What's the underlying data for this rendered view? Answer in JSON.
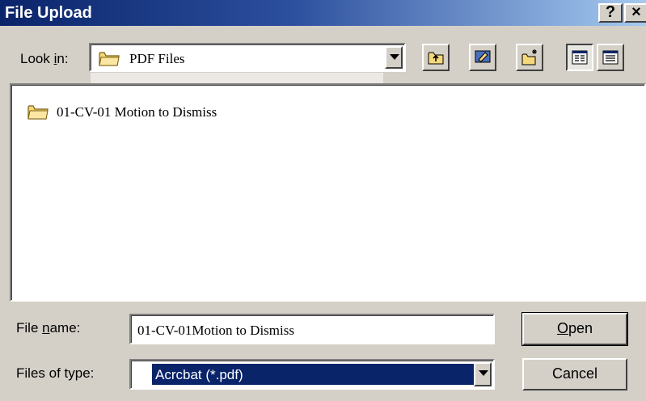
{
  "window": {
    "title": "File Upload",
    "help_label": "?",
    "close_label": "×"
  },
  "look_in": {
    "label_prefix": "Look ",
    "label_accel": "i",
    "label_suffix": "n:",
    "value": "PDF Files",
    "icon": "folder-icon"
  },
  "toolbar": {
    "buttons": [
      {
        "name": "up-one-level",
        "icon": "up-folder-icon"
      },
      {
        "name": "go-to-desktop",
        "icon": "desktop-icon"
      },
      {
        "name": "new-folder",
        "icon": "new-folder-icon"
      },
      {
        "name": "list-view",
        "icon": "list-view-icon",
        "pressed": true
      },
      {
        "name": "details-view",
        "icon": "details-view-icon"
      }
    ]
  },
  "file_list": {
    "items": [
      {
        "label": "01-CV-01 Motion to Dismiss",
        "icon": "folder-icon"
      }
    ]
  },
  "file_name": {
    "label_prefix": "File ",
    "label_accel": "n",
    "label_suffix": "ame:",
    "value": "01-CV-01Motion to Dismiss"
  },
  "file_type": {
    "label": "Files of type:",
    "value": "Acrcbat (*.pdf)"
  },
  "buttons": {
    "open_accel": "O",
    "open_rest": "pen",
    "cancel": "Cancel"
  },
  "colors": {
    "title_gradient_start": "#0a246a",
    "title_gradient_end": "#a6caf0",
    "dialog_face": "#d4d0c8",
    "selection": "#0a246a",
    "folder": "#f5d77c"
  }
}
